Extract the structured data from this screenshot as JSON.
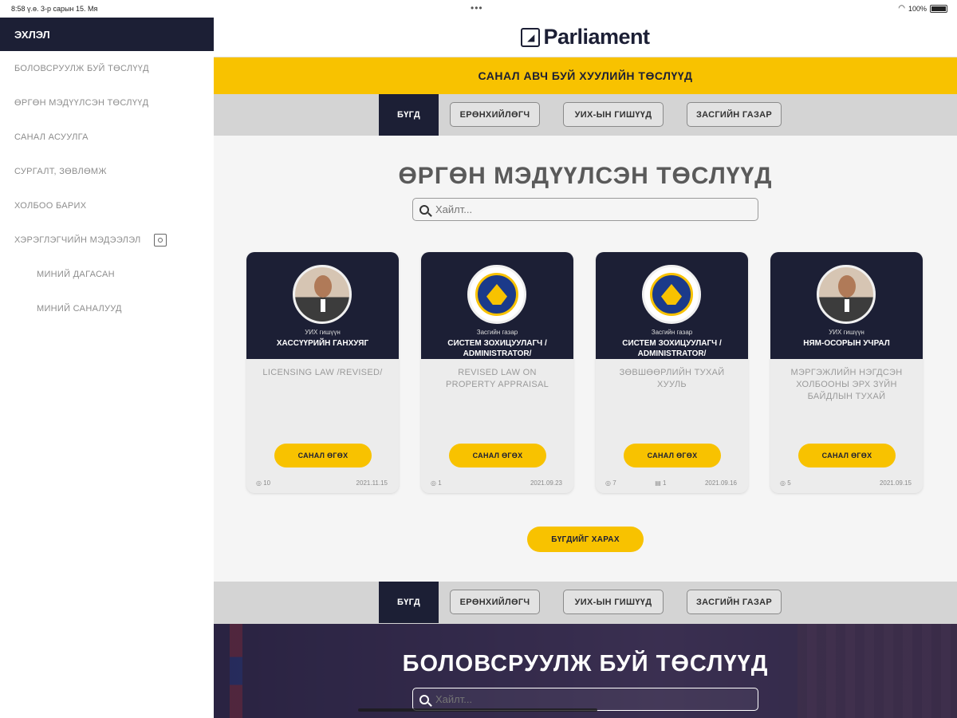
{
  "status_bar": {
    "time": "8:58 ү.ө.   3-р сарын 15. Мя",
    "dots": "•••",
    "battery": "100%"
  },
  "sidebar": {
    "title": "ЭХЛЭЛ",
    "items": [
      {
        "label": "БОЛОВСРУУЛЖ БУЙ ТӨСЛҮҮД"
      },
      {
        "label": "ӨРГӨН МЭДҮҮЛСЭН ТӨСЛҮҮД"
      },
      {
        "label": "САНАЛ АСУУЛГА"
      },
      {
        "label": "СУРГАЛТ, ЗӨВЛӨМЖ"
      },
      {
        "label": "ХОЛБОО БАРИХ"
      },
      {
        "label": "ХЭРЭГЛЭГЧИЙН МЭДЭЭЛЭЛ"
      }
    ],
    "sub_items": [
      {
        "label": "МИНИЙ ДАГАСАН"
      },
      {
        "label": "МИНИЙ САНАЛУУД"
      }
    ]
  },
  "header": {
    "logo_text": "Parliament",
    "banner": "САНАЛ АВЧ БУЙ ХУУЛИЙН ТӨСЛҮҮД"
  },
  "tabs": [
    {
      "label": "БҮГД",
      "active": true
    },
    {
      "label": "ЕРӨНХИЙЛӨГЧ",
      "active": false
    },
    {
      "label": "УИХ-ЫН ГИШҮҮД",
      "active": false
    },
    {
      "label": "ЗАСГИЙН ГАЗАР",
      "active": false
    }
  ],
  "section1": {
    "title": "ӨРГӨН МЭДҮҮЛСЭН ТӨСЛҮҮД",
    "search_placeholder": "Хайлт..."
  },
  "cards": [
    {
      "role": "УИХ гишүүн",
      "name": "ХАССҮҮРИЙН ГАНХУЯГ",
      "title": "LICENSING LAW /REVISED/",
      "button": "САНАЛ ӨГӨХ",
      "views": "◎ 10",
      "comments": "",
      "date": "2021.11.15",
      "avatar": "person"
    },
    {
      "role": "Засгийн газар",
      "name": "СИСТЕМ ЗОХИЦУУЛАГЧ / ADMINISTRATOR/",
      "title": "REVISED LAW ON PROPERTY APPRAISAL",
      "button": "САНАЛ ӨГӨХ",
      "views": "◎ 1",
      "comments": "",
      "date": "2021.09.23",
      "avatar": "emblem"
    },
    {
      "role": "Засгийн газар",
      "name": "СИСТЕМ ЗОХИЦУУЛАГЧ / ADMINISTRATOR/",
      "title": "ЗӨВШӨӨРЛИЙН ТУХАЙ ХУУЛЬ",
      "button": "САНАЛ ӨГӨХ",
      "views": "◎ 7",
      "comments": "▤ 1",
      "date": "2021.09.16",
      "avatar": "emblem"
    },
    {
      "role": "УИХ гишүүн",
      "name": "НЯМ-ОСОРЫН УЧРАЛ",
      "title": "МЭРГЭЖЛИЙН НЭГДСЭН ХОЛБООНЫ ЭРХ ЗҮЙН БАЙДЛЫН ТУХАЙ",
      "button": "САНАЛ ӨГӨХ",
      "views": "◎ 5",
      "comments": "",
      "date": "2021.09.15",
      "avatar": "person"
    }
  ],
  "see_all": "БҮГДИЙГ ХАРАХ",
  "section2": {
    "title": "БОЛОВСРУУЛЖ БУЙ ТӨСЛҮҮД",
    "search_placeholder": "Хайлт..."
  },
  "colors": {
    "navy": "#1c1f35",
    "accent": "#f8c200"
  }
}
